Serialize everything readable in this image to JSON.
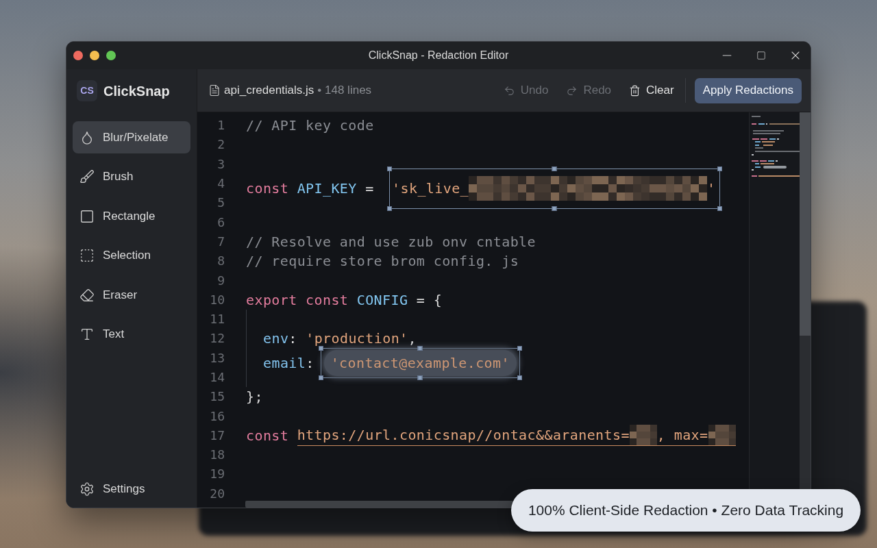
{
  "window": {
    "title": "ClickSnap - Redaction Editor"
  },
  "sidebar": {
    "logo": "CS",
    "app_name": "ClickSnap",
    "tools": [
      {
        "label": "Blur/Pixelate",
        "selected": true
      },
      {
        "label": "Brush",
        "selected": false
      },
      {
        "label": "Rectangle",
        "selected": false
      },
      {
        "label": "Selection",
        "selected": false
      },
      {
        "label": "Eraser",
        "selected": false
      },
      {
        "label": "Text",
        "selected": false
      }
    ],
    "settings": "Settings"
  },
  "toolbar": {
    "file_name": "api_credentials.js",
    "file_info": "• 148 lines",
    "actions": [
      {
        "label": "Undo",
        "disabled": true
      },
      {
        "label": "Redo",
        "disabled": true
      },
      {
        "label": "Clear",
        "disabled": false
      }
    ],
    "primary_button": "Apply Redactions"
  },
  "editor": {
    "lines": [
      {
        "number": "1",
        "tokens": [
          {
            "kind": "comment",
            "text": "// API key code"
          }
        ]
      },
      {
        "number": "2"
      },
      {
        "number": "3"
      },
      {
        "number": "4",
        "tokens": [
          {
            "kind": "keyword",
            "text": "const "
          },
          {
            "kind": "identifier",
            "text": "API_KEY"
          },
          {
            "kind": "operator",
            "text": " = "
          },
          {
            "kind": "pixelation",
            "selected": true,
            "tokens": [
              {
                "kind": "string",
                "text": "'sk_live_"
              },
              {
                "kind": "mosaic"
              },
              {
                "kind": "string",
                "text": "'"
              }
            ]
          }
        ]
      },
      {
        "number": "5"
      },
      {
        "number": "6"
      },
      {
        "number": "7",
        "tokens": [
          {
            "kind": "comment",
            "text": "// Resolve and use zub onv cntable"
          }
        ]
      },
      {
        "number": "8",
        "tokens": [
          {
            "kind": "comment",
            "text": "// require store brom config. js"
          }
        ]
      },
      {
        "number": "9"
      },
      {
        "number": "10",
        "tokens": [
          {
            "kind": "keyword",
            "text": "export const "
          },
          {
            "kind": "identifier",
            "text": "CONFIG"
          },
          {
            "kind": "operator",
            "text": " = {"
          }
        ],
        "children": [
          {
            "number": "11"
          },
          {
            "number": "12",
            "tokens": [
              {
                "kind": "property",
                "text": "env"
              },
              {
                "kind": "operator",
                "text": ": "
              },
              {
                "kind": "string",
                "text": "'production'"
              },
              {
                "kind": "operator",
                "text": ","
              }
            ]
          },
          {
            "number": "13",
            "tokens": [
              {
                "kind": "property",
                "text": "email"
              },
              {
                "kind": "operator",
                "text": ":"
              },
              {
                "kind": "blur",
                "selected": true,
                "tokens": [
                  {
                    "kind": "string",
                    "text": "'contact@example.com'"
                  }
                ]
              }
            ]
          },
          {
            "number": "14"
          }
        ]
      },
      {
        "number": "15",
        "tokens": [
          {
            "kind": "operator",
            "text": "};"
          }
        ]
      },
      {
        "number": "16"
      },
      {
        "number": "17",
        "tokens": [
          {
            "kind": "keyword",
            "text": "const "
          },
          {
            "kind": "link",
            "tokens": [
              {
                "kind": "string",
                "text": "https://url.conicsnap//ontac&&aranents="
              },
              {
                "kind": "mosaic"
              },
              {
                "kind": "string",
                "text": ", max="
              },
              {
                "kind": "mosaic"
              }
            ]
          }
        ]
      },
      {
        "number": "18"
      },
      {
        "number": "19"
      },
      {
        "number": "20"
      }
    ]
  },
  "badge": "100% Client-Side Redaction • Zero Data Tracking"
}
